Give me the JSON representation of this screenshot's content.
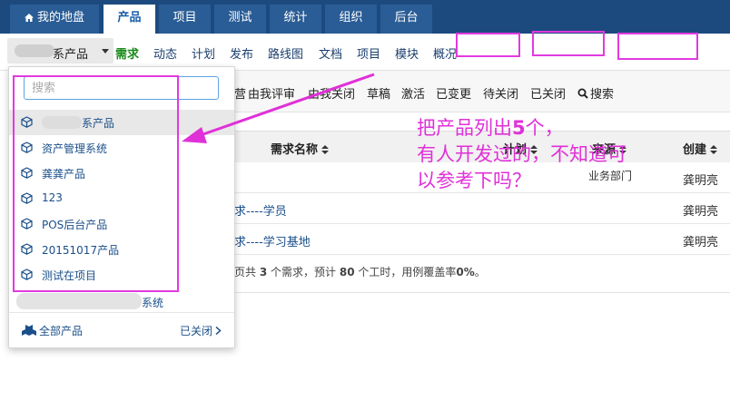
{
  "topnav": {
    "tabs": [
      {
        "label": "我的地盘",
        "icon": "home-icon"
      },
      {
        "label": "产品"
      },
      {
        "label": "项目"
      },
      {
        "label": "测试"
      },
      {
        "label": "统计"
      },
      {
        "label": "组织"
      },
      {
        "label": "后台"
      }
    ],
    "active_tab": "产品"
  },
  "subnav": {
    "product_switch_label": "系产品",
    "items": [
      "需求",
      "动态",
      "计划",
      "发布",
      "路线图",
      "文档",
      "项目",
      "模块",
      "概况"
    ],
    "current": "需求"
  },
  "filterbar": {
    "items": [
      "由我评审",
      "由我关闭",
      "草稿",
      "激活",
      "已变更",
      "待关闭",
      "已关闭",
      "搜索"
    ],
    "partial_left": "营"
  },
  "table": {
    "headers": [
      "需求名称",
      "计划",
      "来源",
      "创建"
    ],
    "rows": [
      {
        "title": "",
        "source": "业务部门",
        "creator": "龚明亮"
      },
      {
        "title": "求----学员",
        "source": "",
        "creator": "龚明亮"
      },
      {
        "title": "求----学习基地",
        "source": "",
        "creator": "龚明亮"
      }
    ],
    "summary_prefix": "页共",
    "summary_count": "3",
    "summary_mid": "个需求，预计",
    "summary_hours": "80",
    "summary_mid2": "个工时，用例覆盖率",
    "summary_rate": "0%",
    "summary_end": "。"
  },
  "dropdown": {
    "search_placeholder": "搜索",
    "products": [
      "系产品",
      "资产管理系统",
      "龚龚产品",
      "123",
      "POS后台产品",
      "20151017产品",
      "测试在项目"
    ],
    "extra_item": "系统",
    "footer_all": "全部产品",
    "footer_closed": "已关闭"
  },
  "annotation": {
    "line1_prefix": "把产品列出",
    "line1_number": "5",
    "line1_suffix": "个，",
    "line2": "有人开发过的，不知道可",
    "line3": "以参考下吗？"
  },
  "colors": {
    "nav_bg": "#1c4a7e",
    "nav_tab": "#2a5d96",
    "link": "#1a4f8a",
    "current_green": "#1a8a1a",
    "annotation_magenta": "#e030d8"
  }
}
